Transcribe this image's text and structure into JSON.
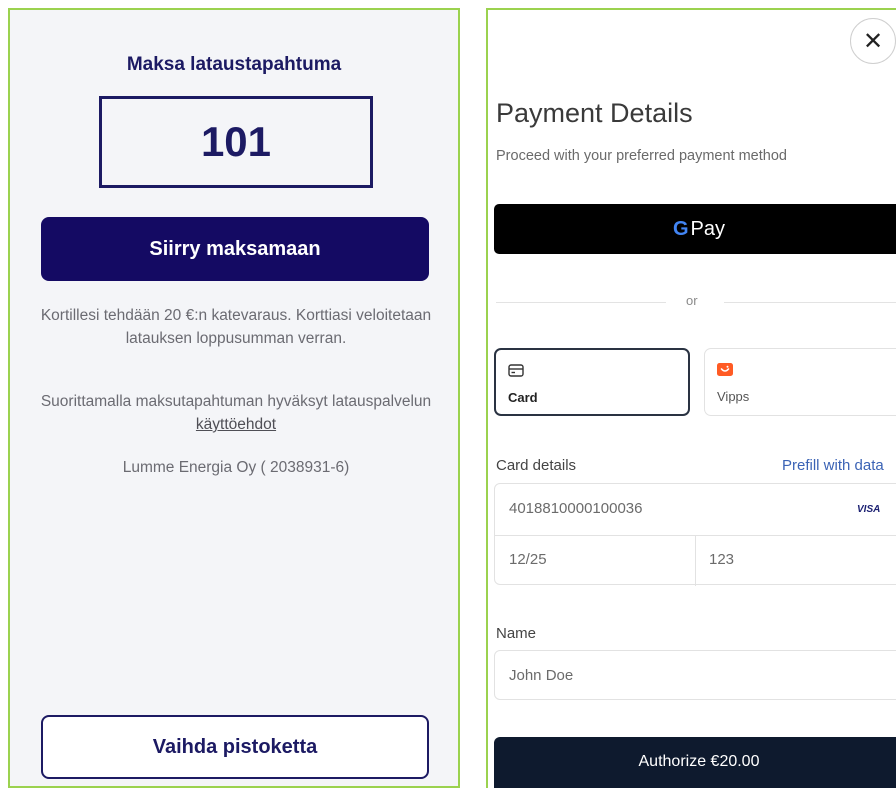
{
  "left": {
    "title": "Maksa lataustapahtuma",
    "code": "101",
    "pay_button": "Siirry maksamaan",
    "info1": "Kortillesi tehdään 20 €:n katevaraus. Korttiasi veloitetaan latauksen loppusumman verran.",
    "info2_prefix": "Suorittamalla maksutapahtuman hyväksyt latauspalvelun",
    "info2_link": "käyttöehdot",
    "company": "Lumme Energia Oy ( 2038931-6)",
    "change_button": "Vaihda pistoketta"
  },
  "right": {
    "close_glyph": "✕",
    "title": "Payment Details",
    "subtitle": "Proceed with your preferred payment method",
    "gpay_g": "G",
    "gpay_text": "Pay",
    "or_text": "or",
    "methods": [
      {
        "label": "Card",
        "icon": "credit-card-icon",
        "selected": true
      },
      {
        "label": "Vipps",
        "icon": "vipps-icon",
        "selected": false
      }
    ],
    "card_details_label": "Card details",
    "prefill_link": "Prefill with data",
    "card_number": "4018810000100036",
    "card_brand": "VISA",
    "expiry": "12/25",
    "cvc": "123",
    "name_label": "Name",
    "name_value": "John Doe",
    "authorize_button": "Authorize €20.00"
  },
  "colors": {
    "brand_navy": "#140a63",
    "panel_border": "#9bd24f",
    "link_blue": "#3b63b5",
    "vipps_orange": "#ff5b24"
  }
}
